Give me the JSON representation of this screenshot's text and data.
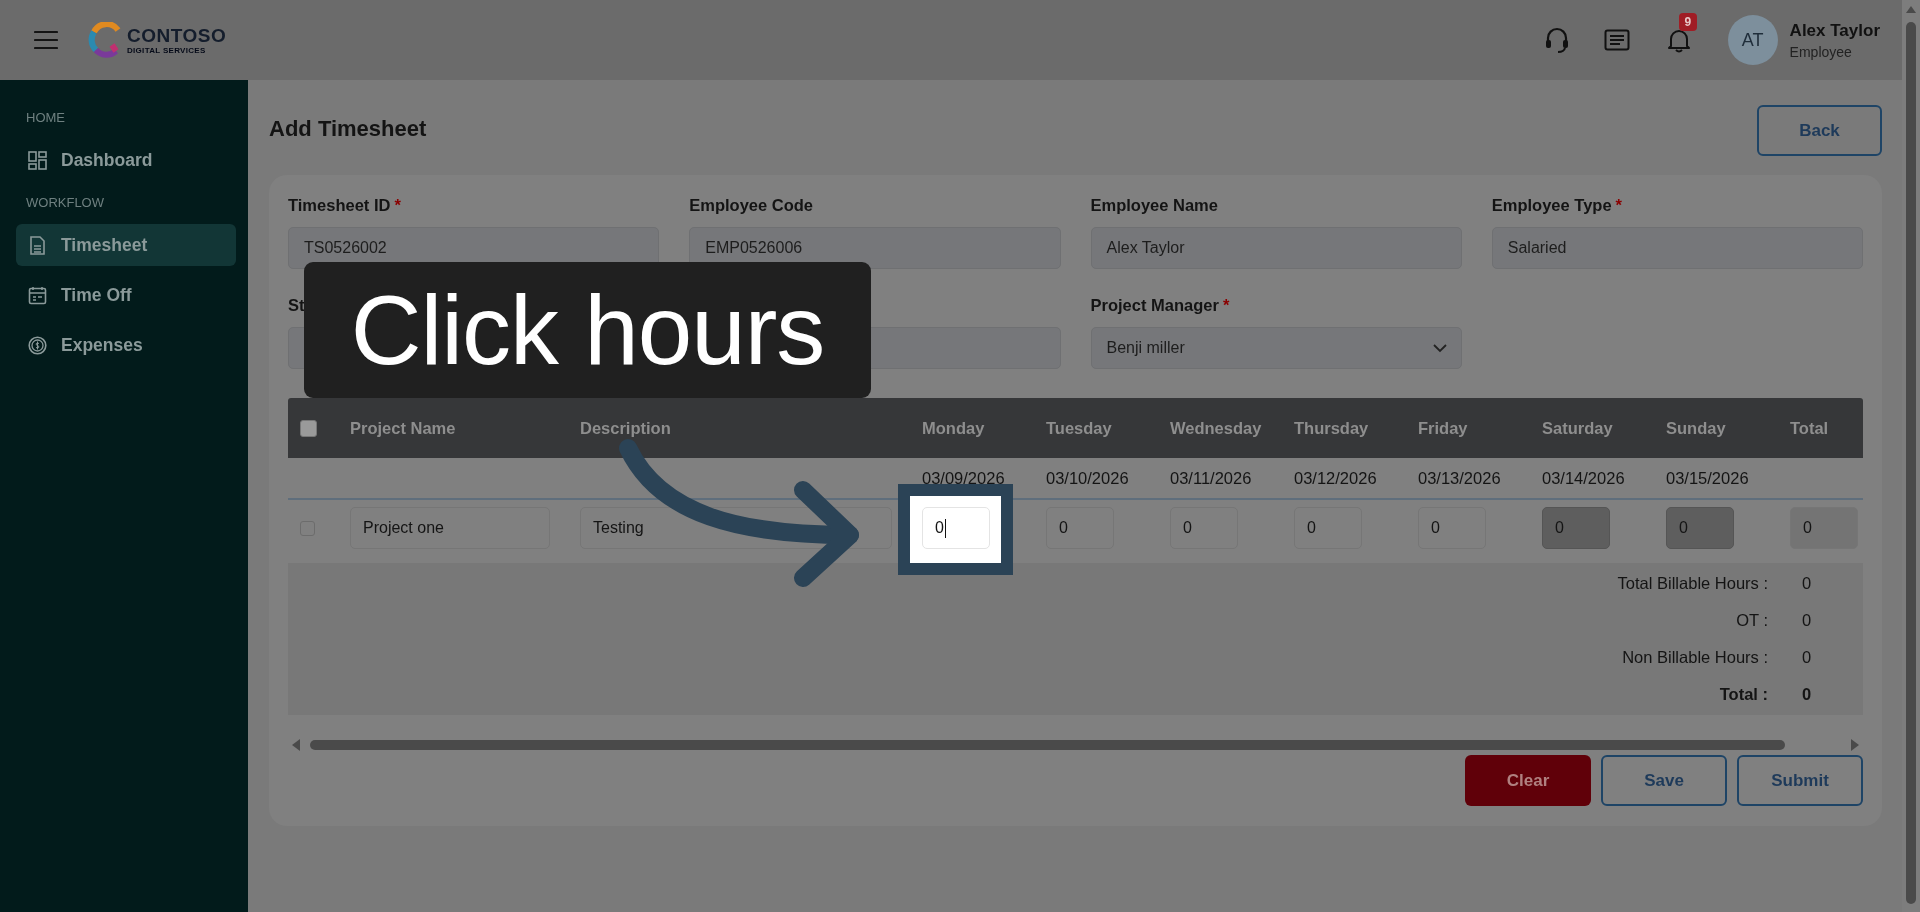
{
  "header": {
    "logo": {
      "name": "CONTOSO",
      "tagline": "DIGITAL SERVICES"
    },
    "notification_count": "9",
    "user": {
      "initials": "AT",
      "name": "Alex Taylor",
      "role": "Employee"
    }
  },
  "sidebar": {
    "sections": [
      {
        "heading": "HOME",
        "items": [
          {
            "label": "Dashboard",
            "kind": "dashboard",
            "selected": false
          }
        ]
      },
      {
        "heading": "WORKFLOW",
        "items": [
          {
            "label": "Timesheet",
            "kind": "timesheet",
            "selected": true
          },
          {
            "label": "Time Off",
            "kind": "calendar",
            "selected": false
          },
          {
            "label": "Expenses",
            "kind": "expenses",
            "selected": false
          }
        ]
      }
    ]
  },
  "page": {
    "title": "Add Timesheet",
    "back_button": "Back"
  },
  "form": {
    "fields": [
      {
        "label": "Timesheet ID",
        "required_mark": "*",
        "value": "TS0526002",
        "kind": "text"
      },
      {
        "label": "Employee Code",
        "value": "EMP0526006",
        "kind": "text"
      },
      {
        "label": "Employee Name",
        "value": "Alex Taylor",
        "kind": "text"
      },
      {
        "label": "Employee Type",
        "required_mark": "*",
        "value": "Salaried",
        "kind": "text"
      },
      {
        "label": "St",
        "kind": "text"
      },
      {
        "kind": "text"
      },
      {
        "label": "Project Manager",
        "required_mark": "*",
        "value": "Benji miller",
        "kind": "select"
      }
    ]
  },
  "table": {
    "select_all": {
      "checked": false
    },
    "columns": [
      "Project Name",
      "Description",
      "Monday",
      "Tuesday",
      "Wednesday",
      "Thursday",
      "Friday",
      "Saturday",
      "Sunday",
      "Total"
    ],
    "dates": [
      "03/09/2026",
      "03/10/2026",
      "03/11/2026",
      "03/12/2026",
      "03/13/2026",
      "03/14/2026",
      "03/15/2026"
    ],
    "rows": [
      {
        "selected": false,
        "project": "Project one",
        "description": "Testing",
        "hours": [
          {
            "value": "0",
            "disabled": false,
            "focused": true
          },
          {
            "value": "0",
            "disabled": false,
            "focused": false
          },
          {
            "value": "0",
            "disabled": false,
            "focused": false
          },
          {
            "value": "0",
            "disabled": false,
            "focused": false
          },
          {
            "value": "0",
            "disabled": false,
            "focused": false
          },
          {
            "value": "0",
            "disabled": true,
            "focused": false
          },
          {
            "value": "0",
            "disabled": true,
            "focused": false
          }
        ],
        "total": "0"
      }
    ]
  },
  "summary": [
    {
      "label": "Total Billable Hours :",
      "value": "0",
      "kind": "normal"
    },
    {
      "label": "OT :",
      "value": "0",
      "kind": "normal"
    },
    {
      "label": "Non Billable Hours :",
      "value": "0",
      "kind": "normal"
    },
    {
      "label": "Total :",
      "value": "0",
      "kind": "total"
    }
  ],
  "actions": [
    {
      "label": "Clear",
      "kind": "danger"
    },
    {
      "label": "Save",
      "kind": "outline"
    },
    {
      "label": "Submit",
      "kind": "outline"
    }
  ],
  "tutorial": {
    "callout": "Click hours"
  }
}
